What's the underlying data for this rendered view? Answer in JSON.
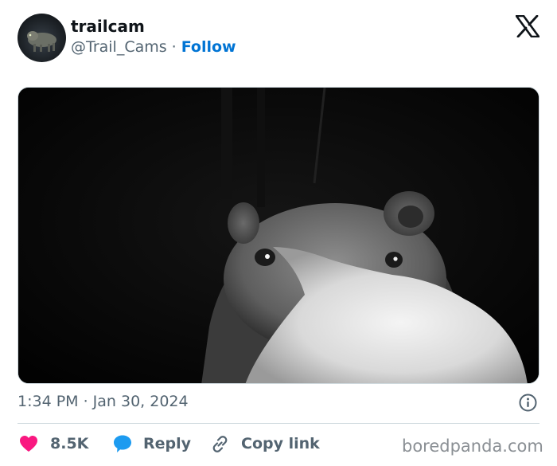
{
  "author": {
    "name": "trailcam",
    "handle": "@Trail_Cams",
    "separator": "·",
    "follow_label": "Follow"
  },
  "brand": {
    "logo_icon": "x-logo-icon"
  },
  "media": {
    "description_icon": "trailcam-bear-photo"
  },
  "meta": {
    "timestamp": "1:34 PM · Jan 30, 2024",
    "info_icon": "info-icon"
  },
  "actions": {
    "like": {
      "icon": "heart-icon",
      "count": "8.5K",
      "color": "#f91880"
    },
    "reply": {
      "icon": "speech-bubble-icon",
      "label": "Reply",
      "color": "#1d9bf0"
    },
    "copy": {
      "icon": "link-icon",
      "label": "Copy link"
    }
  },
  "watermark": "boredpanda.com",
  "colors": {
    "accent": "#0074d4",
    "muted": "#536471",
    "border": "#cfd9de"
  }
}
